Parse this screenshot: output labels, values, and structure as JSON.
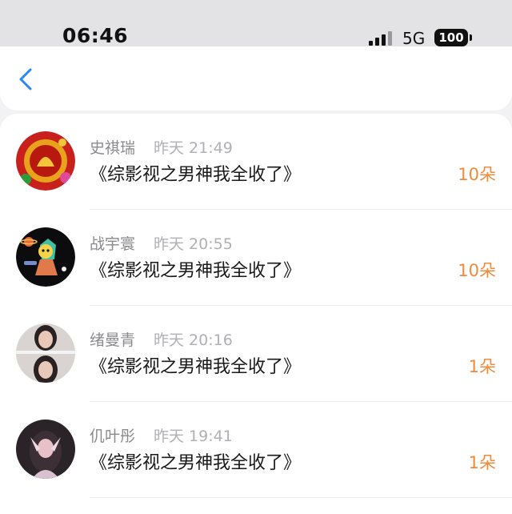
{
  "status_bar": {
    "time": "06:46",
    "network": "5G",
    "battery": "100"
  },
  "nav": {
    "back_icon": "chevron-left-icon",
    "accent": "#2a86f0"
  },
  "colors": {
    "gift_count": "#f08a3c",
    "name": "#8a8a8e",
    "timestamp": "#b0b0b4"
  },
  "records": [
    {
      "name": "史祺瑞",
      "time": "昨天 21:49",
      "title": "《综影视之男神我全收了》",
      "gift": "10朵"
    },
    {
      "name": "战宇寰",
      "time": "昨天 20:55",
      "title": "《综影视之男神我全收了》",
      "gift": "10朵"
    },
    {
      "name": "绪曼青",
      "time": "昨天 20:16",
      "title": "《综影视之男神我全收了》",
      "gift": "1朵"
    },
    {
      "name": "仉叶彤",
      "time": "昨天 19:41",
      "title": "《综影视之男神我全收了》",
      "gift": "1朵"
    }
  ]
}
